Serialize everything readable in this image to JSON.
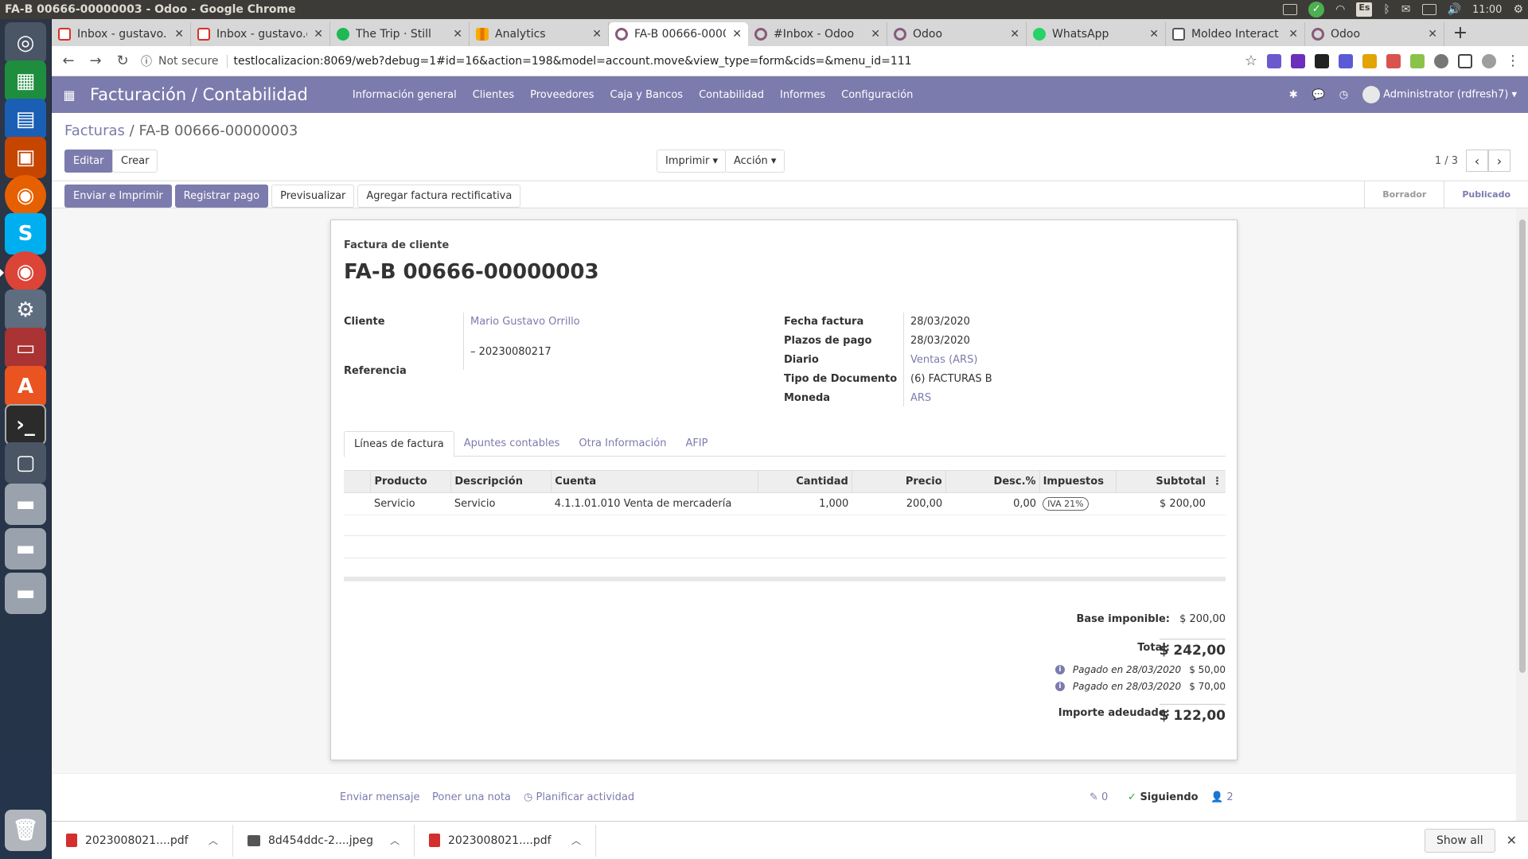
{
  "window_title": "FA-B 00666-00000003 - Odoo - Google Chrome",
  "system_tray": {
    "lang": "Es",
    "time": "11:00"
  },
  "tabs": [
    {
      "title": "Inbox - gustavo.",
      "icon": "gmail-icon"
    },
    {
      "title": "Inbox - gustavo.o",
      "icon": "gmail-icon"
    },
    {
      "title": "The Trip · Still",
      "icon": "spotify-icon"
    },
    {
      "title": "Analytics",
      "icon": "analytics-icon"
    },
    {
      "title": "FA-B 00666-0000",
      "icon": "odoo-icon",
      "active": true
    },
    {
      "title": "#Inbox - Odoo",
      "icon": "odoo-icon"
    },
    {
      "title": "Odoo",
      "icon": "odoo-icon"
    },
    {
      "title": "WhatsApp",
      "icon": "whatsapp-icon"
    },
    {
      "title": "Moldeo Interact",
      "icon": "moldeo-icon"
    },
    {
      "title": "Odoo",
      "icon": "odoo-icon"
    }
  ],
  "address": {
    "security": "Not secure",
    "url": "testlocalizacion:8069/web?debug=1#id=16&action=198&model=account.move&view_type=form&cids=&menu_id=111"
  },
  "odoo_nav": {
    "app_title": "Facturación / Contabilidad",
    "menus": [
      "Información general",
      "Clientes",
      "Proveedores",
      "Caja y Bancos",
      "Contabilidad",
      "Informes",
      "Configuración"
    ],
    "user": "Administrator (rdfresh7)"
  },
  "control": {
    "breadcrumb_parent": "Facturas",
    "breadcrumb_sep": "/",
    "breadcrumb_current": "FA-B 00666-00000003",
    "edit": "Editar",
    "create": "Crear",
    "print": "Imprimir",
    "action": "Acción",
    "pager": "1 / 3"
  },
  "status": {
    "buttons": [
      "Enviar e Imprimir",
      "Registrar pago",
      "Previsualizar",
      "Agregar factura rectificativa"
    ],
    "stages": [
      "Borrador",
      "Publicado"
    ]
  },
  "invoice": {
    "doc_type": "Factura de cliente",
    "name": "FA-B 00666-00000003",
    "labels": {
      "customer": "Cliente",
      "reference": "Referencia",
      "invoice_date": "Fecha factura",
      "payment_terms": "Plazos de pago",
      "journal": "Diario",
      "document_type": "Tipo de Documento",
      "currency": "Moneda"
    },
    "customer": "Mario Gustavo Orrillo",
    "customer_vat": "– 20230080217",
    "invoice_date": "28/03/2020",
    "payment_terms": "28/03/2020",
    "journal": "Ventas (ARS)",
    "document_type": "(6) FACTURAS B",
    "currency": "ARS"
  },
  "notebook_tabs": [
    "Líneas de factura",
    "Apuntes contables",
    "Otra Información",
    "AFIP"
  ],
  "lines": {
    "headers": [
      "Producto",
      "Descripción",
      "Cuenta",
      "Cantidad",
      "Precio",
      "Desc.%",
      "Impuestos",
      "Subtotal"
    ],
    "rows": [
      {
        "product": "Servicio",
        "description": "Servicio",
        "account": "4.1.1.01.010 Venta de mercadería",
        "qty": "1,000",
        "price": "200,00",
        "discount": "0,00",
        "tax": "IVA 21%",
        "subtotal": "$ 200,00"
      }
    ]
  },
  "totals": {
    "base_label": "Base imponible:",
    "base": "$ 200,00",
    "total_label": "Total:",
    "total": "$ 242,00",
    "payments": [
      {
        "label": "Pagado en 28/03/2020",
        "amount": "$ 50,00"
      },
      {
        "label": "Pagado en 28/03/2020",
        "amount": "$ 70,00"
      }
    ],
    "due_label": "Importe adeudado:",
    "due": "$ 122,00"
  },
  "chatter": {
    "send_message": "Enviar mensaje",
    "log_note": "Poner una nota",
    "schedule": "Planificar actividad",
    "attachments": "0",
    "following": "Siguiendo",
    "followers": "2"
  },
  "downloads": {
    "items": [
      "2023008021....pdf",
      "8d454ddc-2....jpeg",
      "2023008021....pdf"
    ],
    "show_all": "Show all"
  }
}
